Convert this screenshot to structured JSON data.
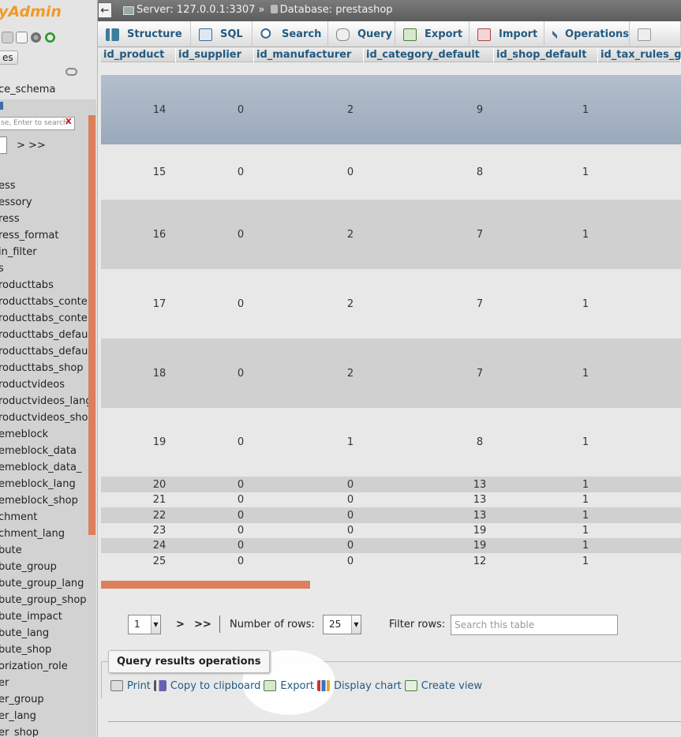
{
  "nav": {
    "logo": "yAdmin",
    "recent_label": "es",
    "db_name": "ce_schema",
    "filter_placeholder": "se, Enter to search",
    "filter_clear": "X",
    "page_next": "> >>",
    "tables": [
      "ess",
      "essory",
      "ress",
      "ress_format",
      "in_filter",
      "s",
      "roducttabs",
      "roducttabs_conte",
      "roducttabs_conte",
      "roducttabs_defau",
      "roducttabs_defau",
      "roducttabs_shop",
      "roductvideos",
      "roductvideos_lang",
      "roductvideos_shop",
      "emeblock",
      "emeblock_data",
      "emeblock_data_",
      "emeblock_lang",
      "emeblock_shop",
      "chment",
      "chment_lang",
      "bute",
      "bute_group",
      "bute_group_lang",
      "bute_group_shop",
      "bute_impact",
      "bute_lang",
      "bute_shop",
      "orization_role",
      "er",
      "er_group",
      "er_lang",
      "er_shop"
    ]
  },
  "topbar": {
    "back": "←",
    "server": "Server: 127.0.0.1:3307",
    "sep": "»",
    "database": "Database: prestashop"
  },
  "tabs": [
    {
      "label": "Structure",
      "icon": "structure-icon"
    },
    {
      "label": "SQL",
      "icon": "sql-icon"
    },
    {
      "label": "Search",
      "icon": "search-icon"
    },
    {
      "label": "Query",
      "icon": "query-icon"
    },
    {
      "label": "Export",
      "icon": "export-icon"
    },
    {
      "label": "Import",
      "icon": "import-icon"
    },
    {
      "label": "Operations",
      "icon": "wrench-icon"
    },
    {
      "label": "",
      "icon": "more-icon"
    }
  ],
  "table": {
    "columns": [
      "id_product",
      "id_supplier",
      "id_manufacturer",
      "id_category_default",
      "id_shop_default",
      "id_tax_rules_g"
    ],
    "rows": [
      [
        "14",
        "0",
        "2",
        "9",
        "1"
      ],
      [
        "15",
        "0",
        "0",
        "8",
        "1"
      ],
      [
        "16",
        "0",
        "2",
        "7",
        "1"
      ],
      [
        "17",
        "0",
        "2",
        "7",
        "1"
      ],
      [
        "18",
        "0",
        "2",
        "7",
        "1"
      ],
      [
        "19",
        "0",
        "1",
        "8",
        "1"
      ],
      [
        "20",
        "0",
        "0",
        "13",
        "1"
      ],
      [
        "21",
        "0",
        "0",
        "13",
        "1"
      ],
      [
        "22",
        "0",
        "0",
        "13",
        "1"
      ],
      [
        "23",
        "0",
        "0",
        "19",
        "1"
      ],
      [
        "24",
        "0",
        "0",
        "19",
        "1"
      ],
      [
        "25",
        "0",
        "0",
        "12",
        "1"
      ]
    ]
  },
  "pager": {
    "page": "1",
    "next": ">",
    "last": ">>",
    "rows_label": "Number of rows:",
    "rows_value": "25",
    "filter_label": "Filter rows:",
    "filter_placeholder": "Search this table"
  },
  "qro": {
    "title": "Query results operations",
    "actions": [
      "Print",
      "Copy to clipboard",
      "Export",
      "Display chart",
      "Create view"
    ]
  }
}
